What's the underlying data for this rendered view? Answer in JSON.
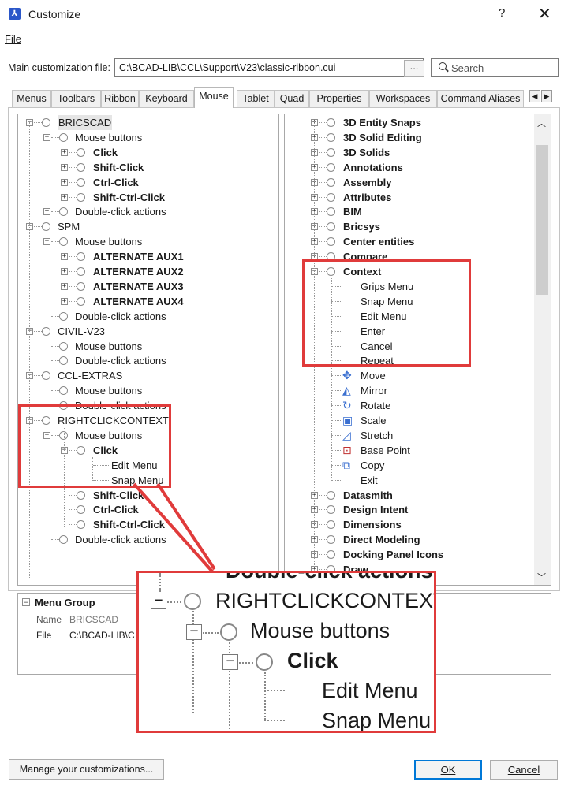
{
  "window": {
    "title": "Customize",
    "help": "?",
    "close": "✕"
  },
  "menubar": {
    "file": "File"
  },
  "customization_file": {
    "label": "Main customization file:",
    "value": "C:\\BCAD-LIB\\CCL\\Support\\V23\\classic-ribbon.cui",
    "browse": "...",
    "search_placeholder": "Search"
  },
  "tabs": [
    "Menus",
    "Toolbars",
    "Ribbon",
    "Keyboard",
    "Mouse",
    "Tablet",
    "Quad",
    "Properties",
    "Workspaces",
    "Command Aliases"
  ],
  "active_tab": "Mouse",
  "left_tree": [
    {
      "label": "BRICSCAD",
      "level": 0,
      "expander": "minus",
      "bold": false,
      "hl": true
    },
    {
      "label": "Mouse buttons",
      "level": 1,
      "expander": "minus",
      "bold": false
    },
    {
      "label": "Click",
      "level": 2,
      "expander": "plus",
      "bold": true
    },
    {
      "label": "Shift-Click",
      "level": 2,
      "expander": "plus",
      "bold": true
    },
    {
      "label": "Ctrl-Click",
      "level": 2,
      "expander": "plus",
      "bold": true
    },
    {
      "label": "Shift-Ctrl-Click",
      "level": 2,
      "expander": "plus",
      "bold": true
    },
    {
      "label": "Double-click actions",
      "level": 1,
      "expander": "plus",
      "bold": false
    },
    {
      "label": "SPM",
      "level": 0,
      "expander": "minus",
      "bold": false
    },
    {
      "label": "Mouse buttons",
      "level": 1,
      "expander": "minus",
      "bold": false
    },
    {
      "label": "ALTERNATE AUX1",
      "level": 2,
      "expander": "plus",
      "bold": true
    },
    {
      "label": "ALTERNATE AUX2",
      "level": 2,
      "expander": "plus",
      "bold": true
    },
    {
      "label": "ALTERNATE AUX3",
      "level": 2,
      "expander": "plus",
      "bold": true
    },
    {
      "label": "ALTERNATE AUX4",
      "level": 2,
      "expander": "plus",
      "bold": true
    },
    {
      "label": "Double-click actions",
      "level": 1,
      "expander": "none",
      "bold": false
    },
    {
      "label": "CIVIL-V23",
      "level": 0,
      "expander": "minus",
      "bold": false
    },
    {
      "label": "Mouse buttons",
      "level": 1,
      "expander": "none",
      "bold": false
    },
    {
      "label": "Double-click actions",
      "level": 1,
      "expander": "none",
      "bold": false
    },
    {
      "label": "CCL-EXTRAS",
      "level": 0,
      "expander": "minus",
      "bold": false
    },
    {
      "label": "Mouse buttons",
      "level": 1,
      "expander": "none",
      "bold": false
    },
    {
      "label": "Double-click actions",
      "level": 1,
      "expander": "none",
      "bold": false
    },
    {
      "label": "RIGHTCLICKCONTEXT",
      "level": 0,
      "expander": "minus",
      "bold": false
    },
    {
      "label": "Mouse buttons",
      "level": 1,
      "expander": "minus",
      "bold": false
    },
    {
      "label": "Click",
      "level": 2,
      "expander": "minus",
      "bold": true
    },
    {
      "label": "Edit Menu",
      "level": 3,
      "expander": "none",
      "bold": false,
      "leaf": true
    },
    {
      "label": "Snap Menu",
      "level": 3,
      "expander": "none",
      "bold": false,
      "leaf": true
    },
    {
      "label": "Shift-Click",
      "level": 2,
      "expander": "none",
      "bold": true
    },
    {
      "label": "Ctrl-Click",
      "level": 2,
      "expander": "none",
      "bold": true
    },
    {
      "label": "Shift-Ctrl-Click",
      "level": 2,
      "expander": "none",
      "bold": true
    },
    {
      "label": "Double-click actions",
      "level": 1,
      "expander": "none",
      "bold": false
    }
  ],
  "right_tree": [
    {
      "label": "3D Entity Snaps",
      "type": "group",
      "expander": "plus"
    },
    {
      "label": "3D Solid Editing",
      "type": "group",
      "expander": "plus"
    },
    {
      "label": "3D Solids",
      "type": "group",
      "expander": "plus"
    },
    {
      "label": "Annotations",
      "type": "group",
      "expander": "plus"
    },
    {
      "label": "Assembly",
      "type": "group",
      "expander": "plus"
    },
    {
      "label": "Attributes",
      "type": "group",
      "expander": "plus"
    },
    {
      "label": "BIM",
      "type": "group",
      "expander": "plus"
    },
    {
      "label": "Bricsys",
      "type": "group",
      "expander": "plus"
    },
    {
      "label": "Center entities",
      "type": "group",
      "expander": "plus"
    },
    {
      "label": "Compare",
      "type": "group",
      "expander": "plus"
    },
    {
      "label": "Context",
      "type": "group",
      "expander": "minus"
    },
    {
      "label": "Grips Menu",
      "type": "item",
      "icon": "none"
    },
    {
      "label": "Snap Menu",
      "type": "item",
      "icon": "none"
    },
    {
      "label": "Edit Menu",
      "type": "item",
      "icon": "none"
    },
    {
      "label": "Enter",
      "type": "item",
      "icon": "none"
    },
    {
      "label": "Cancel",
      "type": "item",
      "icon": "none"
    },
    {
      "label": "Repeat",
      "type": "item",
      "icon": "none"
    },
    {
      "label": "Move",
      "type": "item",
      "icon": "move-icon"
    },
    {
      "label": "Mirror",
      "type": "item",
      "icon": "mirror-icon"
    },
    {
      "label": "Rotate",
      "type": "item",
      "icon": "rotate-icon"
    },
    {
      "label": "Scale",
      "type": "item",
      "icon": "scale-icon"
    },
    {
      "label": "Stretch",
      "type": "item",
      "icon": "stretch-icon"
    },
    {
      "label": "Base Point",
      "type": "item",
      "icon": "base-point-icon"
    },
    {
      "label": "Copy",
      "type": "item",
      "icon": "copy-icon"
    },
    {
      "label": "Exit",
      "type": "item",
      "icon": "none"
    },
    {
      "label": "Datasmith",
      "type": "group",
      "expander": "plus"
    },
    {
      "label": "Design Intent",
      "type": "group",
      "expander": "plus"
    },
    {
      "label": "Dimensions",
      "type": "group",
      "expander": "plus"
    },
    {
      "label": "Direct Modeling",
      "type": "group",
      "expander": "plus"
    },
    {
      "label": "Docking Panel Icons",
      "type": "group",
      "expander": "plus"
    },
    {
      "label": "Draw",
      "type": "group",
      "expander": "plus"
    }
  ],
  "properties": {
    "header": "Menu Group",
    "rows": [
      {
        "key": "Name",
        "value": "BRICSCAD"
      },
      {
        "key": "File",
        "value": "C:\\BCAD-LIB\\C"
      }
    ]
  },
  "zoom_callout": {
    "top_fragment": "Double-click actions",
    "items": [
      "RIGHTCLICKCONTEXT",
      "Mouse buttons",
      "Click",
      "Edit Menu",
      "Snap Menu"
    ]
  },
  "footer": {
    "manage": "Manage your customizations...",
    "ok": "OK",
    "cancel": "Cancel"
  },
  "colors": {
    "callout": "#e03b3b",
    "selection": "#cce4f7",
    "ok_border": "#0078d7"
  }
}
